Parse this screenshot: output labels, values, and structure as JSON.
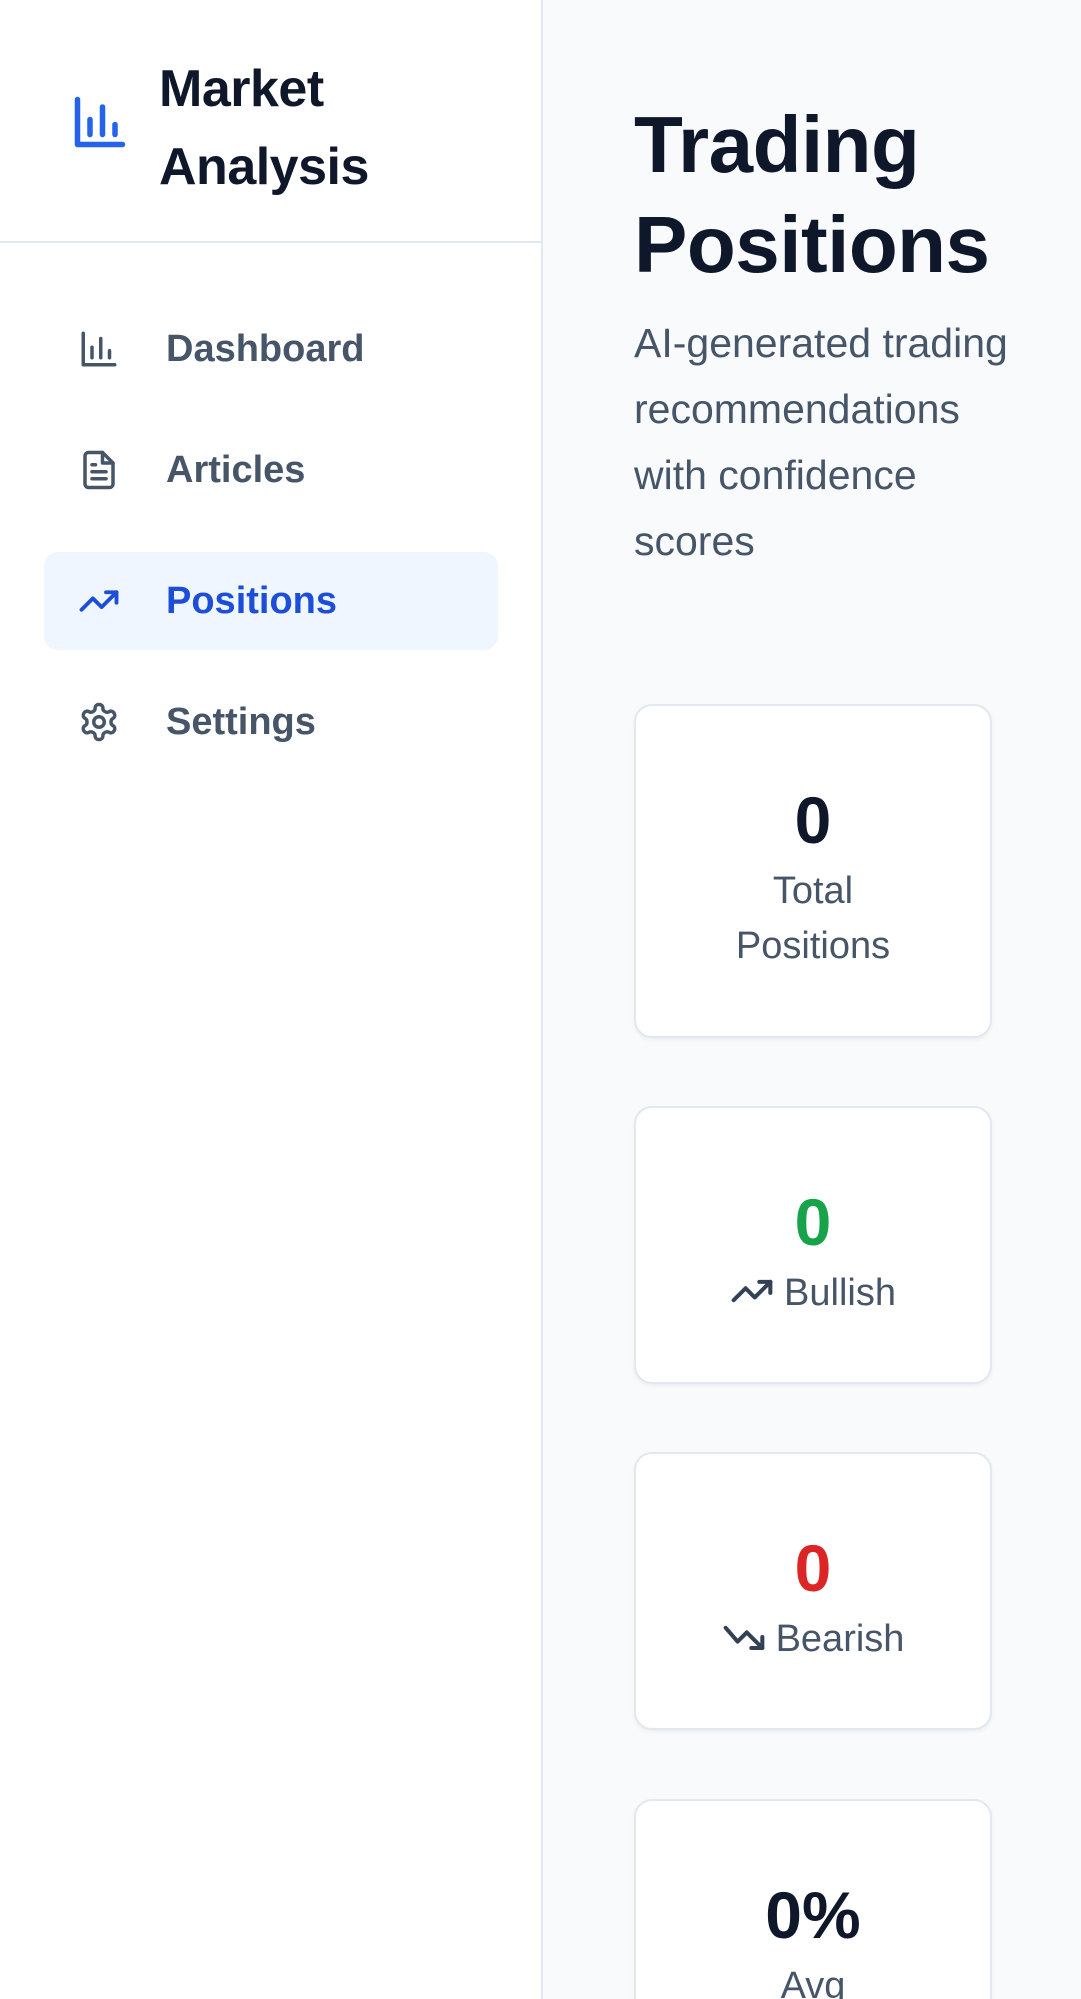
{
  "brand": {
    "icon": "bar-chart-icon",
    "title": "Market Analysis"
  },
  "nav": {
    "items": [
      {
        "label": "Dashboard",
        "icon": "bar-chart-icon",
        "active": false
      },
      {
        "label": "Articles",
        "icon": "document-icon",
        "active": false
      },
      {
        "label": "Positions",
        "icon": "trending-up-icon",
        "active": true
      },
      {
        "label": "Settings",
        "icon": "gear-icon",
        "active": false
      }
    ]
  },
  "page": {
    "title": "Trading Positions",
    "subtitle": "AI-generated trading recommendations with confidence scores"
  },
  "stats": {
    "total": {
      "value": "0",
      "label": "Total Positions"
    },
    "bullish": {
      "value": "0",
      "label": "Bullish",
      "icon": "trending-up-icon"
    },
    "bearish": {
      "value": "0",
      "label": "Bearish",
      "icon": "trending-down-icon"
    },
    "avg": {
      "value": "0%",
      "label": "Avg"
    }
  },
  "colors": {
    "accent": "#1d4ed8",
    "brand_icon": "#2563eb",
    "active_bg": "#eff6ff",
    "bullish": "#16a34a",
    "bearish": "#dc2626",
    "text_dark": "#0f172a",
    "text_muted": "#475569"
  }
}
